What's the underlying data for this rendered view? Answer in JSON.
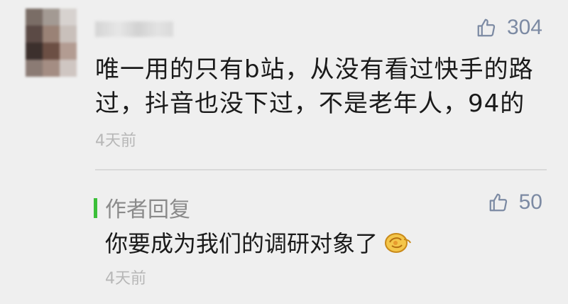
{
  "comment": {
    "like_count": "304",
    "text": "唯一用的只有b站，从没有看过快手的路过，抖音也没下过，不是老年人，94的",
    "time": "4天前"
  },
  "author_reply": {
    "label": "作者回复",
    "like_count": "50",
    "text": "你要成为我们的调研对象了",
    "time": "4天前",
    "emoji": "hand-emoji"
  },
  "colors": {
    "accent_green": "#3bbf39",
    "like_blue": "#7c8aa3",
    "background": "#efefef"
  }
}
